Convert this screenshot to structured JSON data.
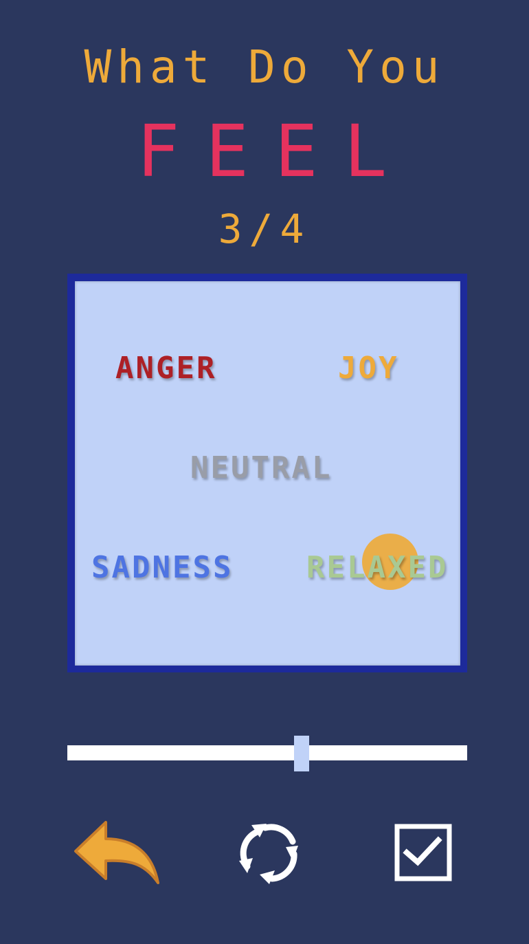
{
  "header": {
    "line1": "What Do You",
    "line2": "FEEL",
    "progress": "3/4"
  },
  "grid": {
    "emotions": {
      "top_left": "ANGER",
      "top_right": "JOY",
      "center": "NEUTRAL",
      "bottom_left": "SADNESS",
      "bottom_right": "RELAXED"
    },
    "selection": "RELAXED"
  },
  "slider": {
    "value_fraction": 0.59
  },
  "controls": {
    "back_icon": "undo-arrow-icon",
    "reset_icon": "refresh-icon",
    "confirm_icon": "checkbox-checked-icon"
  },
  "colors": {
    "background": "#2b375e",
    "title": "#eeaa3a",
    "accent": "#e5325e",
    "grid_border": "#1d2a9b",
    "grid_fill": "#c0d2f8",
    "anger": "#ad2026",
    "joy": "#eeaa3a",
    "neutral": "#999da8",
    "sadness": "#4e74e2",
    "relaxed": "#a9c993"
  }
}
